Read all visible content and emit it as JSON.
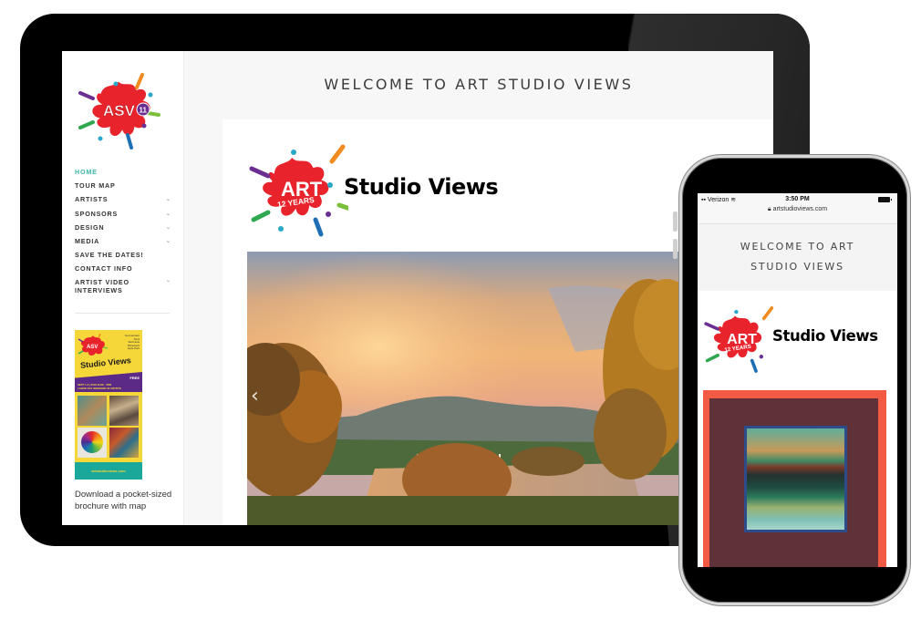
{
  "desktop": {
    "sidebar": {
      "logo_alt": "ASV 11",
      "nav": [
        {
          "label": "HOME",
          "active": true,
          "has_submenu": false
        },
        {
          "label": "TOUR MAP",
          "active": false,
          "has_submenu": false
        },
        {
          "label": "ARTISTS",
          "active": false,
          "has_submenu": true
        },
        {
          "label": "SPONSORS",
          "active": false,
          "has_submenu": true
        },
        {
          "label": "DESIGN",
          "active": false,
          "has_submenu": true
        },
        {
          "label": "MEDIA",
          "active": false,
          "has_submenu": true
        },
        {
          "label": "SAVE THE DATES!",
          "active": false,
          "has_submenu": false
        },
        {
          "label": "CONTACT INFO",
          "active": false,
          "has_submenu": false
        },
        {
          "label": "ARTIST VIDEO INTERVIEWS",
          "active": false,
          "has_submenu": true
        }
      ],
      "chevron_glyph": "⌄",
      "brochure": {
        "towns": "Germantown\nTivoli\nRed Hook\nRhinebeck\nHyde Park",
        "title": "Studio Views",
        "free": "FREE",
        "dates": "SEPT 1-3 | 2018  11AM - 5PM\nLABOR DAY WEEKEND  30 ARTISTS",
        "footer": "artstudioviews.com"
      },
      "download_text": "Download a pocket-sized brochure with map"
    },
    "main": {
      "heading": "WELCOME TO ART STUDIO VIEWS",
      "logo_badge_line1": "ART",
      "logo_badge_line2": "12 YEARS",
      "site_title": "Studio Views",
      "slider_prev_glyph": "‹"
    }
  },
  "mobile": {
    "status_bar": {
      "carrier": "Verizon",
      "time": "3:50 PM",
      "url": "artstudioviews.com"
    },
    "heading_line1": "WELCOME TO ART",
    "heading_line2": "STUDIO VIEWS",
    "logo_badge_line1": "ART",
    "logo_badge_line2": "12 YEARS",
    "site_title": "Studio Views"
  },
  "colors": {
    "nav_active": "#3eb5a8",
    "splat_red": "#e8232b",
    "brochure_yellow": "#f6d73a",
    "brochure_purple": "#5b2a86",
    "brochure_teal": "#19a89a",
    "artwork_border": "#f25a43"
  }
}
